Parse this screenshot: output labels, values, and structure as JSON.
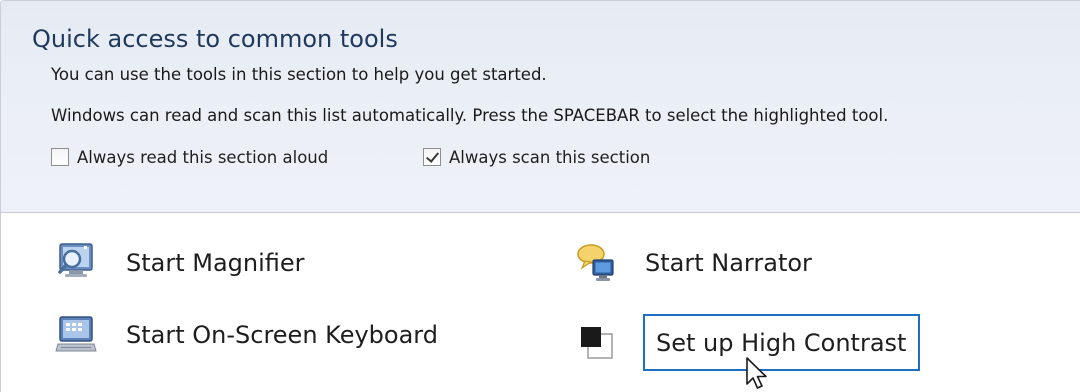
{
  "section": {
    "title": "Quick access to common tools",
    "description1": "You can use the tools in this section to help you get started.",
    "description2": "Windows can read and scan this list automatically.  Press the SPACEBAR to select the highlighted tool.",
    "options": [
      {
        "label": "Always read this section aloud",
        "checked": false
      },
      {
        "label": "Always scan this section",
        "checked": true
      }
    ]
  },
  "tools": [
    {
      "label": "Start Magnifier",
      "icon": "magnifier-icon"
    },
    {
      "label": "Start Narrator",
      "icon": "narrator-icon"
    },
    {
      "label": "Start On-Screen Keyboard",
      "icon": "on-screen-keyboard-icon"
    },
    {
      "label": "Set up High Contrast",
      "icon": "high-contrast-icon",
      "focused": true
    }
  ],
  "colors": {
    "title": "#1e395b",
    "focus_border": "#1e6fc4",
    "header_bg": "#eceff6"
  }
}
